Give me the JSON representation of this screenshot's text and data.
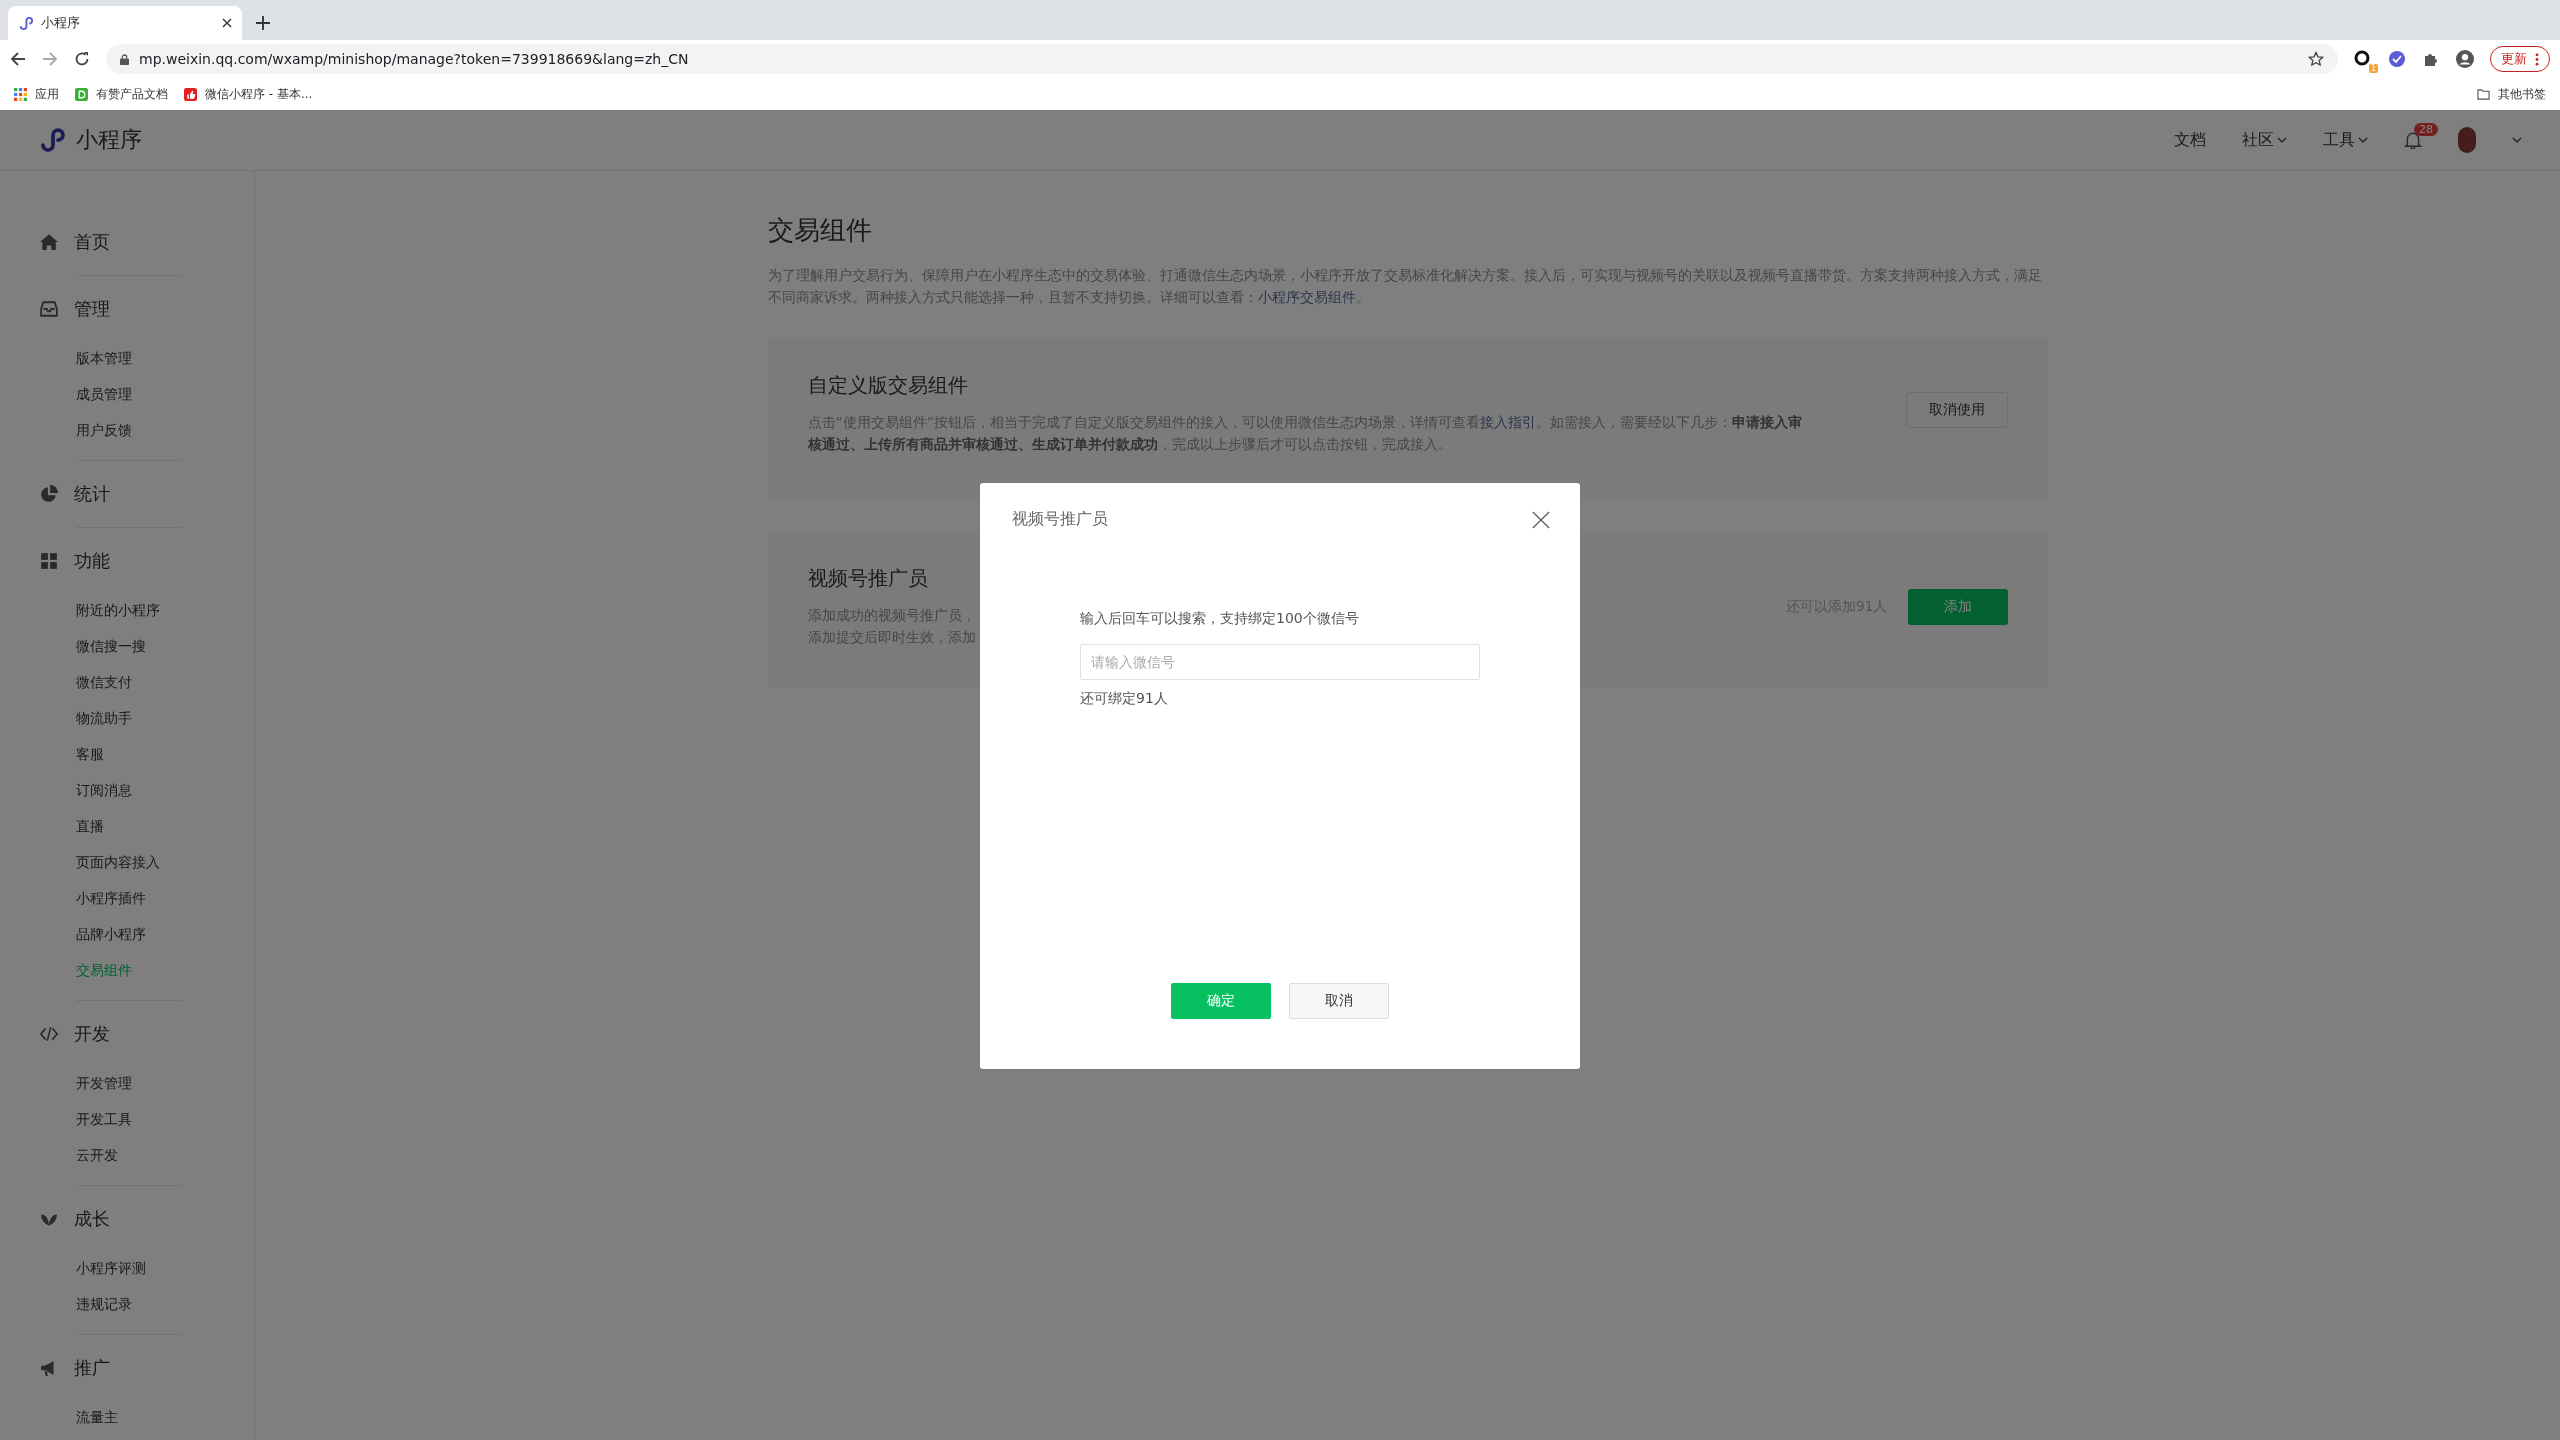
{
  "browser": {
    "tab_title": "小程序",
    "url": "mp.weixin.qq.com/wxamp/minishop/manage?token=739918669&lang=zh_CN",
    "bookmarks": [
      {
        "label": "应用",
        "kind": "apps"
      },
      {
        "label": "有赞产品文档",
        "kind": "d"
      },
      {
        "label": "微信小程序 - 基本...",
        "kind": "thumb"
      }
    ],
    "other_bookmarks": "其他书签",
    "update_button": "更新",
    "extension_badge": "1"
  },
  "header": {
    "logo": "小程序",
    "nav": [
      {
        "label": "文档",
        "dropdown": false
      },
      {
        "label": "社区",
        "dropdown": true
      },
      {
        "label": "工具",
        "dropdown": true
      }
    ],
    "notification_count": "28"
  },
  "sidebar": {
    "sections": [
      {
        "title": "首页",
        "kind": "home"
      },
      {
        "title": "管理",
        "kind": "inbox",
        "items": [
          {
            "label": "版本管理",
            "selected": false
          },
          {
            "label": "成员管理",
            "selected": false
          },
          {
            "label": "用户反馈",
            "selected": false
          }
        ]
      },
      {
        "title": "统计",
        "kind": "pie"
      },
      {
        "title": "功能",
        "kind": "grid",
        "items": [
          {
            "label": "附近的小程序",
            "selected": false
          },
          {
            "label": "微信搜一搜",
            "selected": false
          },
          {
            "label": "微信支付",
            "selected": false
          },
          {
            "label": "物流助手",
            "selected": false
          },
          {
            "label": "客服",
            "selected": false
          },
          {
            "label": "订阅消息",
            "selected": false
          },
          {
            "label": "直播",
            "selected": false
          },
          {
            "label": "页面内容接入",
            "selected": false
          },
          {
            "label": "小程序插件",
            "selected": false
          },
          {
            "label": "品牌小程序",
            "selected": false
          },
          {
            "label": "交易组件",
            "selected": true
          }
        ]
      },
      {
        "title": "开发",
        "kind": "code",
        "items": [
          {
            "label": "开发管理",
            "selected": false
          },
          {
            "label": "开发工具",
            "selected": false
          },
          {
            "label": "云开发",
            "selected": false
          }
        ]
      },
      {
        "title": "成长",
        "kind": "leaf",
        "items": [
          {
            "label": "小程序评测",
            "selected": false
          },
          {
            "label": "违规记录",
            "selected": false
          }
        ]
      },
      {
        "title": "推广",
        "kind": "megaphone",
        "items": [
          {
            "label": "流量主",
            "selected": false
          }
        ]
      }
    ]
  },
  "page": {
    "title": "交易组件",
    "intro": [
      {
        "kind": "plain",
        "text": "为了理解用户交易行为、保障用户在小程序生态中的交易体验、打通微信生态内场景，小程序开放了交易标准化解决方案。接入后，可实现与视频号的关联以及视频号直播带货。方案支持两种接入方式，满足不同商家诉求。两种接入方式只能选择一种，且暂不支持切换。详细可以查看："
      },
      {
        "kind": "link",
        "text": "小程序交易组件"
      },
      {
        "kind": "plain",
        "text": "。"
      }
    ],
    "custom_card": {
      "title": "自定义版交易组件",
      "description": [
        {
          "kind": "plain",
          "text": "点击“使用交易组件”按钮后，相当于完成了自定义版交易组件的接入，可以使用微信生态内场景，详情可查看"
        },
        {
          "kind": "link",
          "text": "接入指引"
        },
        {
          "kind": "plain",
          "text": "。如需接入，需要经以下几步："
        },
        {
          "kind": "bold",
          "text": "申请接入审核通过、上传所有商品并审核通过、生成订单并付款成功"
        },
        {
          "kind": "plain",
          "text": "，完成以上步骤后才可以点击按钮，完成接入。"
        }
      ],
      "button": "取消使用"
    },
    "promoter_card": {
      "title": "视频号推广员",
      "description_lines": [
        "添加成功的视频号推广员，",
        "添加提交后即时生效，添加"
      ],
      "quota": "还可以添加91人",
      "button": "添加"
    }
  },
  "dialog": {
    "title": "视频号推广员",
    "hint": "输入后回车可以搜索，支持绑定100个微信号",
    "input": {
      "placeholder": "请输入微信号"
    },
    "remaining": "还可绑定91人",
    "confirm": "确定",
    "cancel": "取消"
  }
}
